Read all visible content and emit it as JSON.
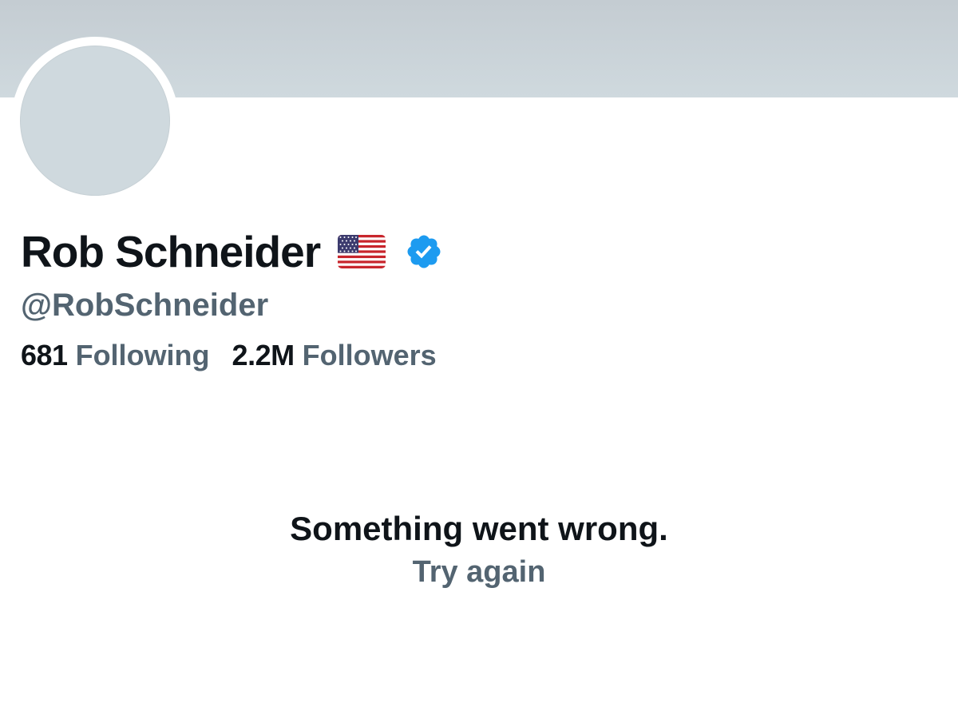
{
  "profile": {
    "display_name": "Rob Schneider",
    "flag_icon": "us-flag-icon",
    "verified_icon": "verified-badge-icon",
    "handle": "@RobSchneider",
    "following_count": "681",
    "following_label": "Following",
    "followers_count": "2.2M",
    "followers_label": "Followers"
  },
  "error": {
    "message": "Something went wrong.",
    "retry_label": "Try again"
  },
  "colors": {
    "banner": "#c4ccd2",
    "avatar_placeholder": "#cfd9de",
    "primary_text": "#0f1419",
    "secondary_text": "#536471",
    "verified_blue": "#1d9bf0"
  }
}
